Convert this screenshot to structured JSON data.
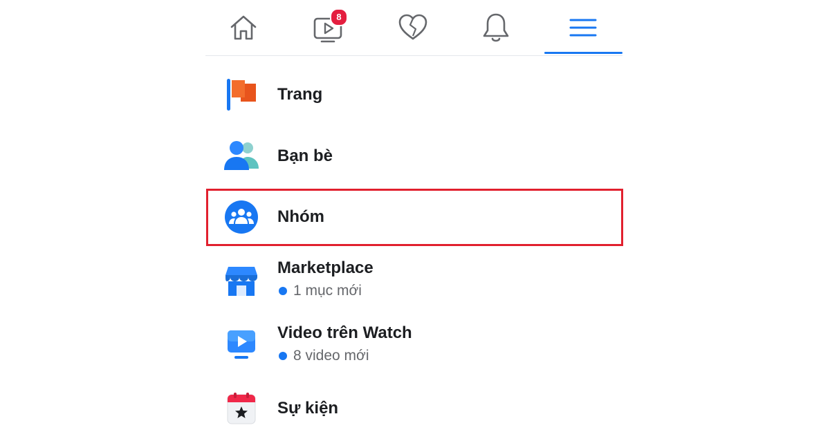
{
  "topnav": {
    "tabs": [
      {
        "name": "home",
        "icon": "home-icon"
      },
      {
        "name": "watch",
        "icon": "watch-tv-icon",
        "badge": "8"
      },
      {
        "name": "dating",
        "icon": "heart-icon"
      },
      {
        "name": "notifications",
        "icon": "bell-icon"
      },
      {
        "name": "menu",
        "icon": "hamburger-menu-icon",
        "active": true
      }
    ],
    "watch_badge": "8",
    "accent_color": "#1877f2",
    "badge_color": "#e41e3f"
  },
  "menu": {
    "items": [
      {
        "label": "Trang",
        "icon": "flag-icon"
      },
      {
        "label": "Bạn bè",
        "icon": "friends-icon"
      },
      {
        "label": "Nhóm",
        "icon": "groups-icon",
        "highlighted": true
      },
      {
        "label": "Marketplace",
        "icon": "marketplace-shop-icon",
        "sub": "1 mục mới"
      },
      {
        "label": "Video trên Watch",
        "icon": "watch-video-icon",
        "sub": "8 video mới"
      },
      {
        "label": "Sự kiện",
        "icon": "calendar-star-icon"
      }
    ]
  },
  "highlight_color": "#e1202e"
}
